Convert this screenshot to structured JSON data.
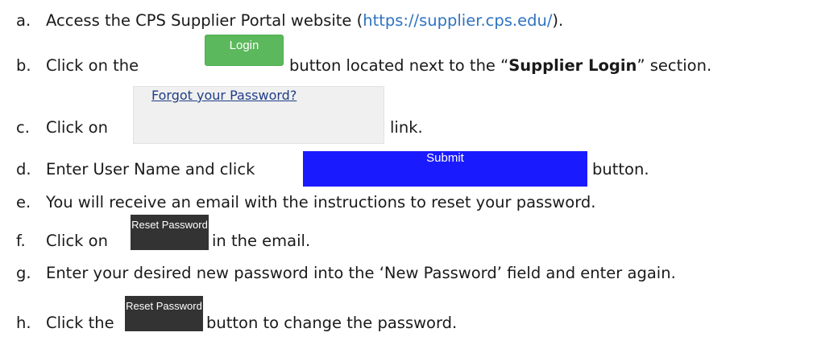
{
  "steps": {
    "a": {
      "letter": "a.",
      "before": "Access the CPS Supplier Portal website (",
      "link": "https://supplier.cps.edu/",
      "after": ")."
    },
    "b": {
      "letter": "b.",
      "before": "Click on the",
      "button": "Login",
      "middle": "button located next to the “",
      "bold": "Supplier Login",
      "after": "” section."
    },
    "c": {
      "letter": "c.",
      "before": "Click on",
      "link": "Forgot your Password?",
      "after": "link."
    },
    "d": {
      "letter": "d.",
      "before": "Enter User Name and click",
      "button": "Submit",
      "after": "button."
    },
    "e": {
      "letter": "e.",
      "text": "You will receive an email with the instructions to reset your password."
    },
    "f": {
      "letter": "f.",
      "before": "Click on",
      "button": "Reset Password",
      "after": "in the email."
    },
    "g": {
      "letter": "g.",
      "text": "Enter your desired new password into the ‘New Password’ field and enter again."
    },
    "h": {
      "letter": "h.",
      "before": "Click the",
      "button": "Reset Password",
      "after": "button to change the password."
    }
  },
  "colors": {
    "link": "#2f74c0",
    "login_button": "#5cb85c",
    "submit_button": "#1a1aff",
    "reset_button": "#333333",
    "forgot_link": "#1f3d86"
  }
}
